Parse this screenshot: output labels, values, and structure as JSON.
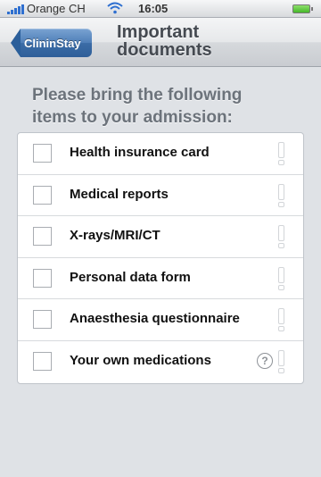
{
  "status_bar": {
    "carrier": "Orange CH",
    "time": "16:05",
    "signal_icon": "signal-bars-icon",
    "wifi_icon": "wifi-icon",
    "battery_icon": "battery-icon"
  },
  "nav": {
    "back_label": "ClininStay",
    "title_line1": "Important",
    "title_line2": "documents"
  },
  "intro": {
    "line1": "Please bring the following",
    "line2": "items to your admission:"
  },
  "checklist": {
    "items": [
      {
        "label": "Health insurance card",
        "checked": false,
        "has_help": false
      },
      {
        "label": "Medical reports",
        "checked": false,
        "has_help": false
      },
      {
        "label": "X-rays/MRI/CT",
        "checked": false,
        "has_help": false
      },
      {
        "label": "Personal data form",
        "checked": false,
        "has_help": false
      },
      {
        "label": "Anaesthesia questionnaire",
        "checked": false,
        "has_help": false
      },
      {
        "label": "Your own medications",
        "checked": false,
        "has_help": true,
        "help_glyph": "?"
      }
    ]
  },
  "colors": {
    "background": "#dfe2e6",
    "accent_blue": "#3b6ca6",
    "battery_green": "#45b82a"
  }
}
